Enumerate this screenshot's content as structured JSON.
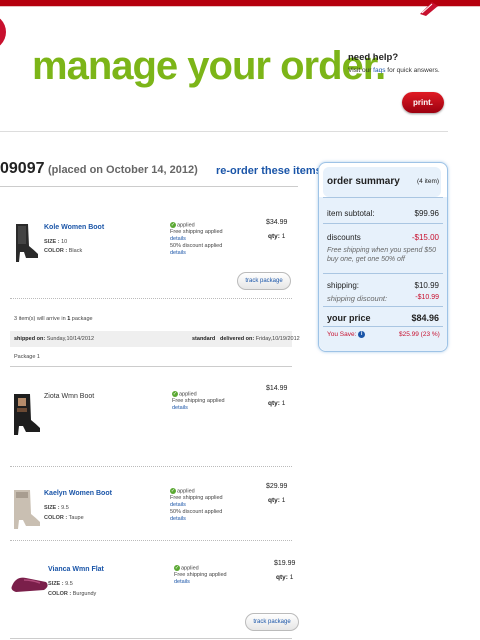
{
  "page": {
    "title": "manage your order.",
    "help": {
      "heading": "need help?",
      "prefix": "Visit our ",
      "link": "faqs",
      "suffix": " for quick answers."
    },
    "print_label": "print."
  },
  "order": {
    "number": "09097",
    "placed": "(placed on October 14, 2012)",
    "reorder_label": "re-order these items"
  },
  "items": [
    {
      "name": "Kole Women Boot",
      "size_label": "SIZE :",
      "size": "10",
      "color_label": "COLOR :",
      "color": "Black",
      "applied": "applied",
      "promo1": "Free shipping applied",
      "details1": "details",
      "promo2": "50% discount applied",
      "details2": "details",
      "price": "$34.99",
      "qty_label": "qty:",
      "qty": "1"
    },
    {
      "name": "Ziota Wmn Boot",
      "applied": "applied",
      "promo1": "Free shipping applied",
      "details1": "details",
      "price": "$14.99",
      "qty_label": "qty:",
      "qty": "1"
    },
    {
      "name": "Kaelyn Women Boot",
      "size_label": "SIZE :",
      "size": "9.5",
      "color_label": "COLOR :",
      "color": "Taupe",
      "applied": "applied",
      "promo1": "Free shipping applied",
      "details1": "details",
      "promo2": "50% discount applied",
      "details2": "details",
      "price": "$29.99",
      "qty_label": "qty:",
      "qty": "1"
    },
    {
      "name": "Vianca Wmn Flat",
      "size_label": "SIZE :",
      "size": "9.5",
      "color_label": "COLOR :",
      "color": "Burgundy",
      "applied": "applied",
      "promo1": "Free shipping applied",
      "details1": "details",
      "price": "$19.99",
      "qty_label": "qty:",
      "qty": "1"
    }
  ],
  "shipment": {
    "arrive_prefix": "3 item(s) will arrive in ",
    "arrive_count": "1",
    "arrive_suffix": " package",
    "shipped_label": "shipped on:",
    "shipped_date": "Sunday,10/14/2012",
    "method": "standard",
    "delivered_label": "delivered on:",
    "delivered_date": "Friday,10/19/2012",
    "package_label": "Package 1",
    "track_label": "track package"
  },
  "summary": {
    "title": "order summary",
    "count": "(4 item)",
    "subtotal_label": "item subtotal:",
    "subtotal": "$99.96",
    "discounts_label": "discounts",
    "discounts": "-$15.00",
    "discount_note": "Free shipping when you spend $50 buy one, get one 50% off",
    "shipping_label": "shipping:",
    "shipping": "$10.99",
    "shipping_discount_label": "shipping discount:",
    "shipping_discount": "-$10.99",
    "price_label": "your price",
    "price": "$84.96",
    "save_label": "You Save:",
    "save_value": "$25.99 (23 %)"
  },
  "colors": {
    "brand_green": "#7cb518",
    "brand_red": "#c8102e",
    "link_blue": "#1a55a8",
    "summary_bg": "#e7f1fb"
  }
}
